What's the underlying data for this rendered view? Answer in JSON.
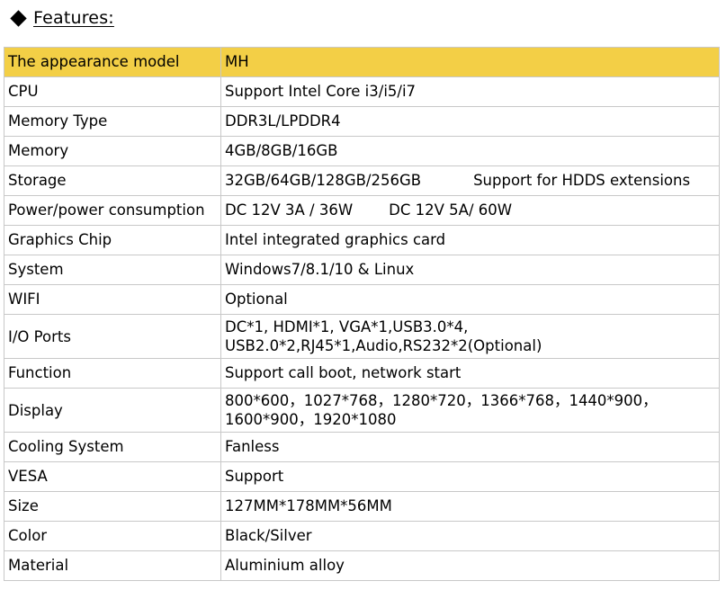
{
  "heading": {
    "bullet_icon": "black-diamond",
    "title": "Features:"
  },
  "colors": {
    "header_bg": "#f3cf46",
    "border": "#c8c8c8"
  },
  "table": {
    "header": {
      "label": "The appearance model",
      "value": "MH"
    },
    "rows": [
      {
        "label": "CPU",
        "value": "Support Intel Core i3/i5/i7"
      },
      {
        "label": "Memory Type",
        "value": "DDR3L/LPDDR4"
      },
      {
        "label": "Memory",
        "value": "4GB/8GB/16GB"
      },
      {
        "label": "Storage",
        "value": "32GB/64GB/128GB/256GB",
        "value_extra": "Support for HDDS extensions"
      },
      {
        "label": "Power/power consumption",
        "value": "DC 12V 3A / 36W",
        "value_extra": "DC 12V 5A/ 60W"
      },
      {
        "label": "Graphics Chip",
        "value": "Intel integrated graphics card"
      },
      {
        "label": "System",
        "value": "Windows7/8.1/10 & Linux"
      },
      {
        "label": "WIFI",
        "value": "Optional"
      },
      {
        "label": "I/O Ports",
        "value_line1": "DC*1, HDMI*1, VGA*1,USB3.0*4,",
        "value_line2": "USB2.0*2,RJ45*1,Audio,RS232*2(Optional)"
      },
      {
        "label": "Function",
        "value": "Support call boot, network start"
      },
      {
        "label": "Display",
        "value_line1": "800*600，1027*768，1280*720，1366*768，1440*900，",
        "value_line2": "1600*900，1920*1080"
      },
      {
        "label": "Cooling System",
        "value": "Fanless"
      },
      {
        "label": "VESA",
        "value": "Support"
      },
      {
        "label": "Size",
        "value": "127MM*178MM*56MM"
      },
      {
        "label": "Color",
        "value": "Black/Silver"
      },
      {
        "label": "Material",
        "value": "Aluminium alloy"
      }
    ]
  }
}
